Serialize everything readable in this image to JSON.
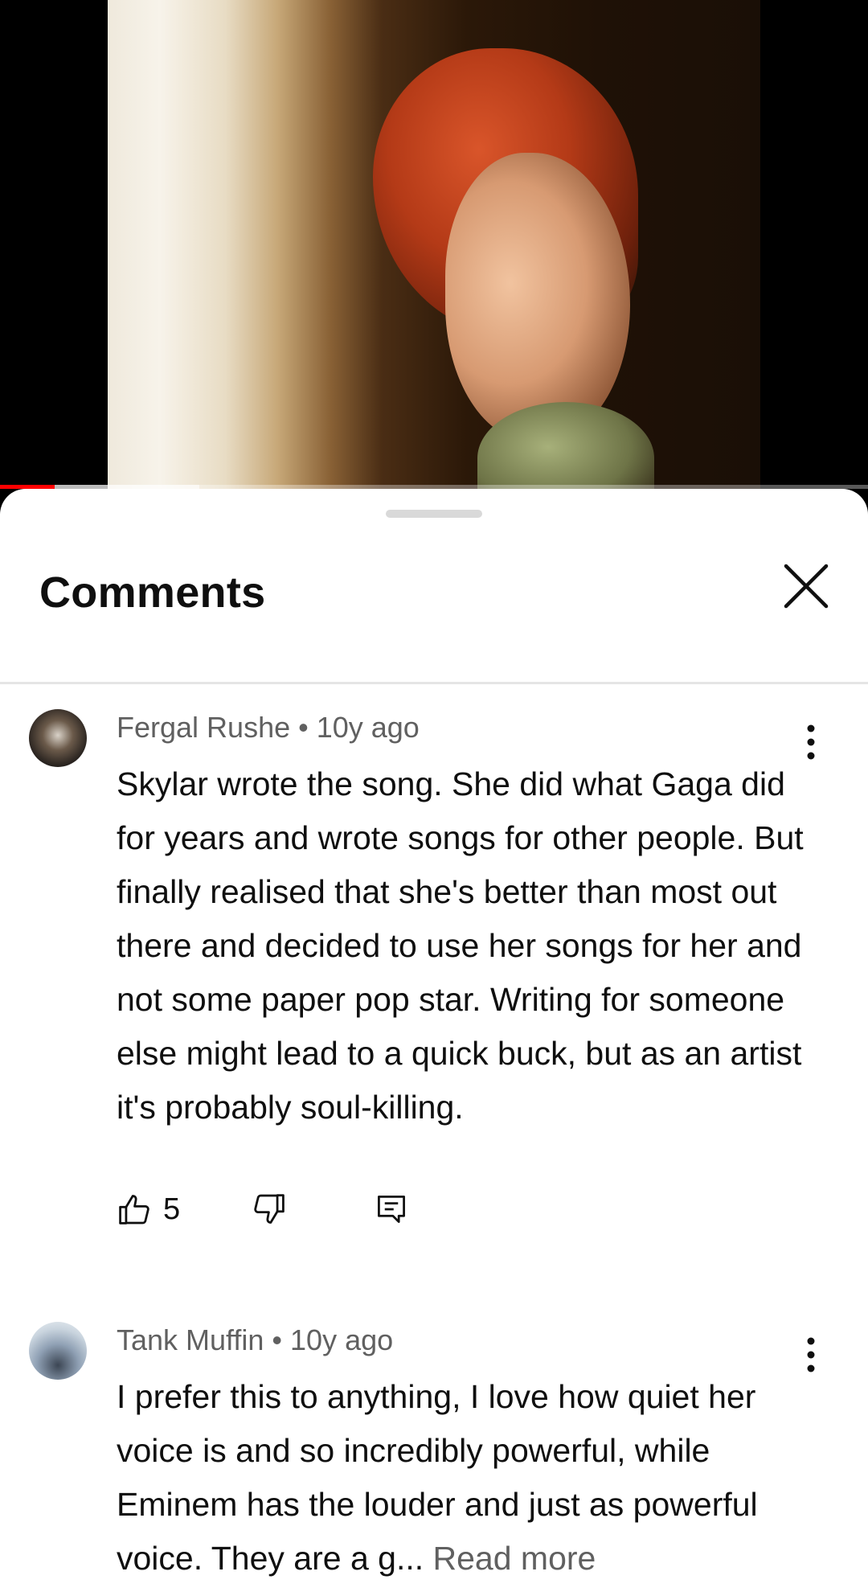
{
  "player": {
    "progress_played": 0.063,
    "progress_buffered": 0.23,
    "played_color": "#ff0000"
  },
  "comments_panel": {
    "title": "Comments",
    "close_icon": "close-icon"
  },
  "comments": [
    {
      "author": "Fergal Rushe",
      "time": "10y ago",
      "meta": "Fergal Rushe • 10y ago",
      "text": "Skylar wrote the song. She did what Gaga did for years and wrote songs for other people. But finally realised that she's better than most out there and decided to use her songs for her and not some paper pop star. Writing for someone else might lead to a quick buck, but as an artist it's probably soul-killing.",
      "likes": "5"
    },
    {
      "author": "Tank Muffin",
      "time": "10y ago",
      "meta": "Tank Muffin • 10y ago",
      "text": "I prefer this to anything, I love how quiet her voice is and so incredibly powerful, while Eminem has the louder and just as powerful voice. They are a g...",
      "read_more": " Read more"
    }
  ]
}
